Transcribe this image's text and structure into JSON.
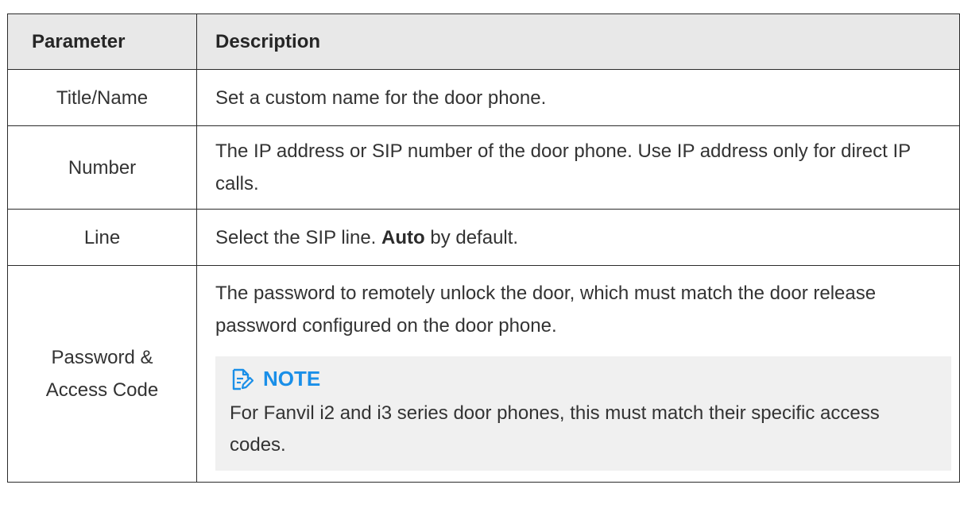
{
  "table": {
    "headers": {
      "parameter": "Parameter",
      "description": "Description"
    },
    "rows": [
      {
        "parameter": "Title/Name",
        "description": "Set a custom name for the door phone."
      },
      {
        "parameter": "Number",
        "description": "The IP address or SIP number of the door phone. Use IP address only for direct IP calls."
      },
      {
        "parameter": "Line",
        "description_before": "Select the SIP line. ",
        "description_bold": "Auto",
        "description_after": " by default."
      },
      {
        "parameter": "Password & Access Code",
        "description": "The password to remotely unlock the door, which must match the door release password configured on the door phone.",
        "note": {
          "icon": "note-edit-icon",
          "heading": "NOTE",
          "text": "For Fanvil i2 and i3 series door phones, this must match their specific access codes."
        }
      }
    ]
  },
  "colors": {
    "header_background": "#e8e8e8",
    "note_background": "#f0f0f0",
    "note_accent": "#1a8fe8",
    "border": "#2b2b2b"
  }
}
